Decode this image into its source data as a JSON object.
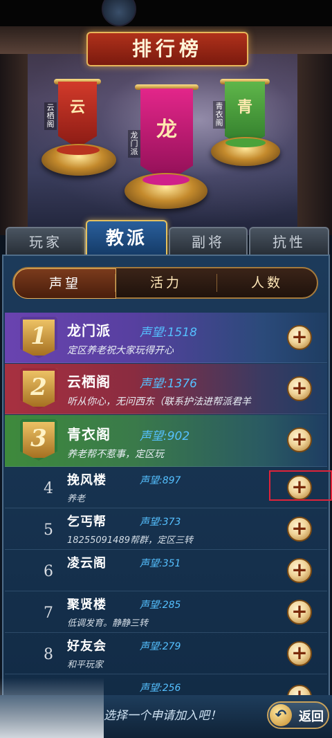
{
  "header": {
    "title": "排行榜"
  },
  "podium": {
    "first": {
      "banner_char": "龙",
      "side_label": "龙门派"
    },
    "second": {
      "banner_char": "云",
      "side_label": "云栖阁"
    },
    "third": {
      "banner_char": "青",
      "side_label": "青衣阁"
    }
  },
  "main_tabs": [
    {
      "label": "玩家",
      "active": false
    },
    {
      "label": "教派",
      "active": true
    },
    {
      "label": "副将",
      "active": false
    },
    {
      "label": "抗性",
      "active": false
    }
  ],
  "sub_tabs": [
    {
      "label": "声望",
      "active": true
    },
    {
      "label": "活力",
      "active": false
    },
    {
      "label": "人数",
      "active": false
    }
  ],
  "rankings": [
    {
      "rank": "1",
      "name": "龙门派",
      "score": "声望:1518",
      "desc": "定区养老祝大家玩得开心"
    },
    {
      "rank": "2",
      "name": "云栖阁",
      "score": "声望:1376",
      "desc": "听从你心，无问西东（联系护法进帮派君羊"
    },
    {
      "rank": "3",
      "name": "青衣阁",
      "score": "声望:902",
      "desc": "养老帮不惹事，定区玩"
    },
    {
      "rank": "4",
      "name": "挽风楼",
      "score": "声望:897",
      "desc": "养老"
    },
    {
      "rank": "5",
      "name": "乞丐帮",
      "score": "声望:373",
      "desc": "18255091489帮群，定区三转"
    },
    {
      "rank": "6",
      "name": "凌云阁",
      "score": "声望:351",
      "desc": ""
    },
    {
      "rank": "7",
      "name": "聚贤楼",
      "score": "声望:285",
      "desc": "低调发育。静静三转"
    },
    {
      "rank": "8",
      "name": "好友会",
      "score": "声望:279",
      "desc": "和平玩家"
    },
    {
      "rank": "",
      "name": "",
      "score": "声望:256",
      "desc": ""
    }
  ],
  "join_symbol": "+",
  "footer": {
    "hint": "选择一个申请加入吧！",
    "back_label": "返回",
    "back_icon": "undo-arrow"
  },
  "colors": {
    "accent_gold": "#e5c15f",
    "score_blue": "#55c0ff",
    "highlight_red": "#e0233a"
  }
}
